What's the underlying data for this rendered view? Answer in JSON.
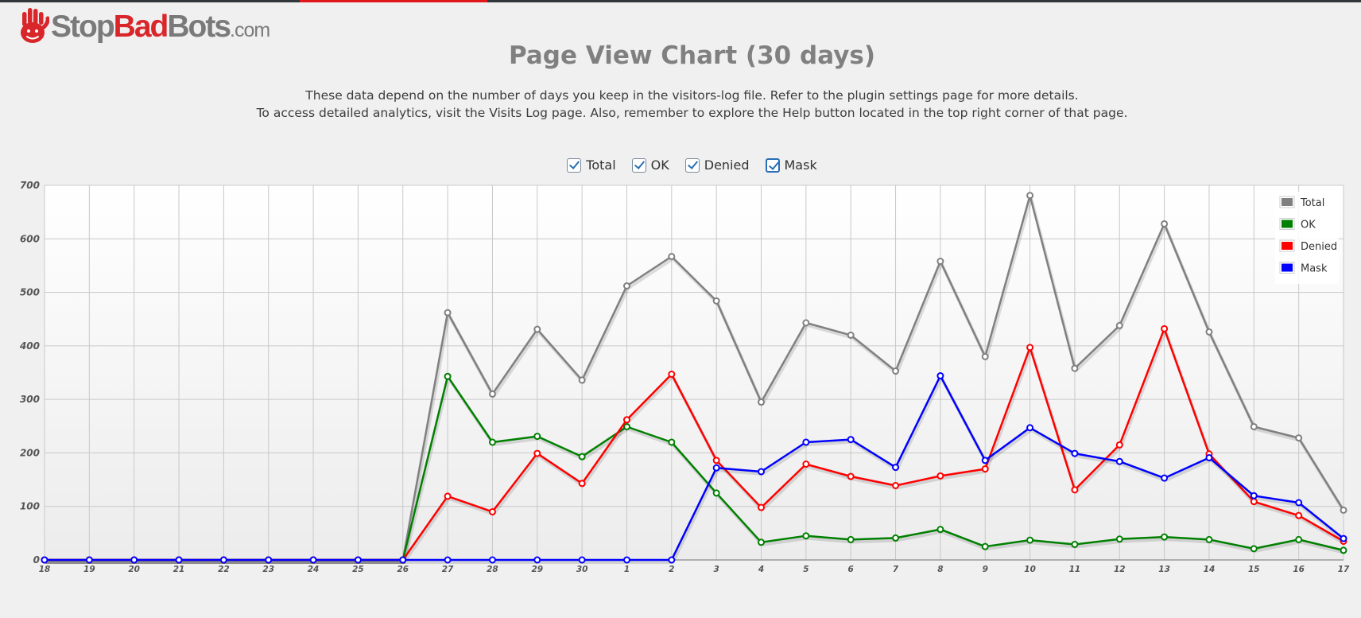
{
  "logo": {
    "part1": "Stop",
    "part2": "Bad",
    "part3": "Bots",
    "part4": ".com"
  },
  "colors": {
    "accent": "#e0181b",
    "total": "#808080",
    "ok": "#008000",
    "denied": "#ff0000",
    "mask": "#0000ff"
  },
  "header": {
    "title": "Page View Chart (30 days)",
    "desc_line1": "These data depend on the number of days you keep in the visitors-log file. Refer to the plugin settings page for more details.",
    "desc_line2": "To access detailed analytics, visit the Visits Log page. Also, remember to explore the Help button located in the top right corner of that page."
  },
  "toggles": [
    {
      "label": "Total",
      "checked": true
    },
    {
      "label": "OK",
      "checked": true
    },
    {
      "label": "Denied",
      "checked": true
    },
    {
      "label": "Mask",
      "checked": true
    }
  ],
  "chart_data": {
    "type": "line",
    "title": "",
    "xlabel": "",
    "ylabel": "",
    "ylim": [
      0,
      700
    ],
    "yticks": [
      0,
      100,
      200,
      300,
      400,
      500,
      600,
      700
    ],
    "grid": true,
    "legend_position": "top-right",
    "categories": [
      "18",
      "19",
      "20",
      "21",
      "22",
      "23",
      "24",
      "25",
      "26",
      "27",
      "28",
      "29",
      "30",
      "1",
      "2",
      "3",
      "4",
      "5",
      "6",
      "7",
      "8",
      "9",
      "10",
      "11",
      "12",
      "13",
      "14",
      "15",
      "16",
      "17"
    ],
    "series": [
      {
        "name": "Total",
        "color": "#808080",
        "values": [
          0,
          0,
          0,
          0,
          0,
          0,
          0,
          0,
          0,
          462,
          310,
          431,
          336,
          512,
          567,
          484,
          295,
          443,
          420,
          353,
          558,
          380,
          681,
          358,
          438,
          628,
          426,
          249,
          228,
          93
        ]
      },
      {
        "name": "OK",
        "color": "#008000",
        "values": [
          0,
          0,
          0,
          0,
          0,
          0,
          0,
          0,
          0,
          343,
          220,
          231,
          193,
          249,
          220,
          125,
          33,
          45,
          38,
          41,
          57,
          25,
          37,
          29,
          39,
          43,
          38,
          21,
          38,
          18
        ]
      },
      {
        "name": "Denied",
        "color": "#ff0000",
        "values": [
          0,
          0,
          0,
          0,
          0,
          0,
          0,
          0,
          0,
          119,
          90,
          199,
          143,
          262,
          347,
          186,
          98,
          179,
          156,
          139,
          157,
          170,
          397,
          131,
          215,
          432,
          198,
          109,
          83,
          35
        ]
      },
      {
        "name": "Mask",
        "color": "#0000ff",
        "values": [
          0,
          0,
          0,
          0,
          0,
          0,
          0,
          0,
          0,
          0,
          0,
          0,
          0,
          0,
          0,
          172,
          165,
          220,
          225,
          173,
          344,
          186,
          247,
          199,
          184,
          153,
          191,
          120,
          107,
          40
        ]
      }
    ]
  }
}
